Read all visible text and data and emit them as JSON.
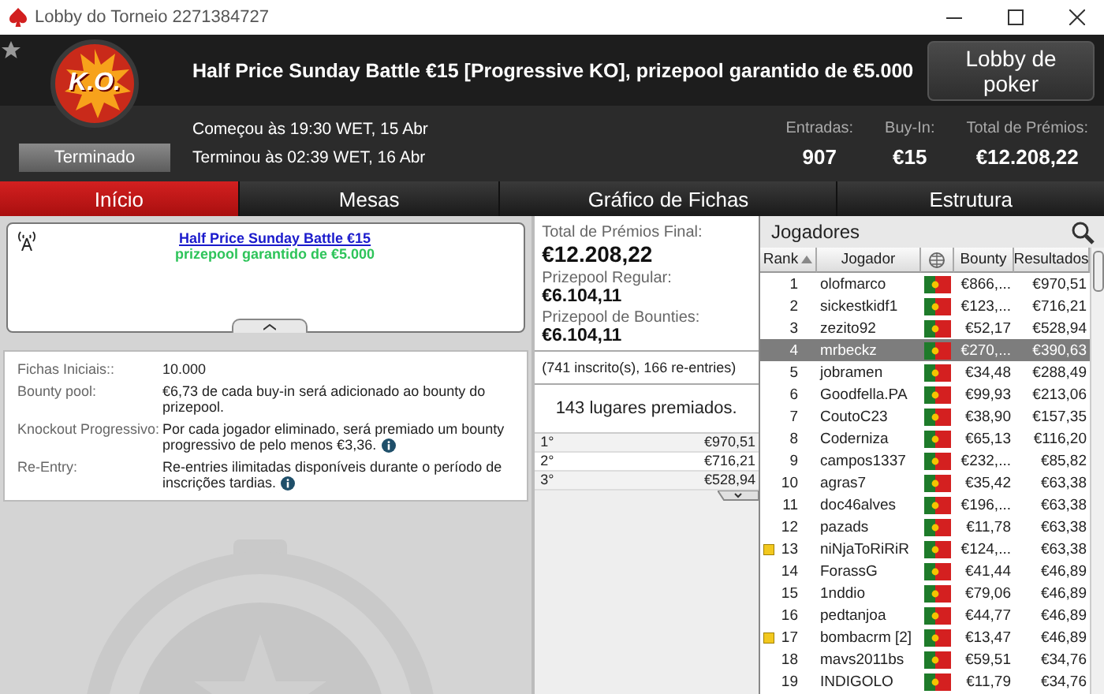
{
  "window": {
    "title": "Lobby do Torneio 2271384727"
  },
  "header": {
    "logo_text": "K.O.",
    "status": "Terminado",
    "title": "Half Price Sunday Battle €15 [Progressive KO], prizepool garantido de €5.000",
    "lobby_button": "Lobby de poker",
    "started": "Começou às 19:30 WET, 15 Abr",
    "ended": "Terminou às 02:39 WET, 16 Abr",
    "stats": [
      {
        "label": "Entradas:",
        "value": "907"
      },
      {
        "label": "Buy-In:",
        "value": "€15"
      },
      {
        "label": "Total de Prémios:",
        "value": "€12.208,22"
      }
    ]
  },
  "tabs": [
    {
      "label": "Início",
      "selected": true
    },
    {
      "label": "Mesas",
      "selected": false
    },
    {
      "label": "Gráfico de Fichas",
      "selected": false
    },
    {
      "label": "Estrutura",
      "selected": false
    }
  ],
  "news": {
    "link": "Half Price Sunday Battle €15",
    "subtitle": "prizepool garantido de €5.000"
  },
  "details": [
    {
      "label": "Fichas Iniciais::",
      "value": "10.000",
      "info": false
    },
    {
      "label": "Bounty pool:",
      "value": "€6,73 de cada buy-in será adicionado ao bounty do prizepool.",
      "info": false
    },
    {
      "label": "Knockout Progressivo:",
      "value": "Por cada jogador eliminado, será premiado um bounty progressivo de pelo menos €3,36.",
      "info": true
    },
    {
      "label": "Re-Entry:",
      "value": "Re-entries ilimitadas disponíveis durante o período de inscrições tardias.",
      "info": true
    }
  ],
  "prizes": {
    "totals": [
      {
        "label": "Total de Prémios Final:",
        "value": "€12.208,22"
      },
      {
        "label": "Prizepool Regular:",
        "value": "€6.104,11"
      },
      {
        "label": "Prizepool de Bounties:",
        "value": "€6.104,11"
      }
    ],
    "entries": "(741 inscrito(s), 166 re-entries)",
    "paid": "143 lugares premiados.",
    "places": [
      {
        "place": "1°",
        "amount": "€970,51"
      },
      {
        "place": "2°",
        "amount": "€716,21"
      },
      {
        "place": "3°",
        "amount": "€528,94"
      }
    ]
  },
  "players": {
    "title": "Jogadores",
    "columns": [
      "Rank",
      "Jogador",
      "Bounty",
      "Resultados"
    ],
    "rows": [
      {
        "rank": "1",
        "name": "olofmarco",
        "bounty": "€866,...",
        "result": "€970,51",
        "selected": false,
        "marked": false
      },
      {
        "rank": "2",
        "name": "sickestkidf1",
        "bounty": "€123,...",
        "result": "€716,21",
        "selected": false,
        "marked": false
      },
      {
        "rank": "3",
        "name": "zezito92",
        "bounty": "€52,17",
        "result": "€528,94",
        "selected": false,
        "marked": false
      },
      {
        "rank": "4",
        "name": "mrbeckz",
        "bounty": "€270,...",
        "result": "€390,63",
        "selected": true,
        "marked": false
      },
      {
        "rank": "5",
        "name": "jobramen",
        "bounty": "€34,48",
        "result": "€288,49",
        "selected": false,
        "marked": false
      },
      {
        "rank": "6",
        "name": "Goodfella.PA",
        "bounty": "€99,93",
        "result": "€213,06",
        "selected": false,
        "marked": false
      },
      {
        "rank": "7",
        "name": "CoutoC23",
        "bounty": "€38,90",
        "result": "€157,35",
        "selected": false,
        "marked": false
      },
      {
        "rank": "8",
        "name": "Coderniza",
        "bounty": "€65,13",
        "result": "€116,20",
        "selected": false,
        "marked": false
      },
      {
        "rank": "9",
        "name": "campos1337",
        "bounty": "€232,...",
        "result": "€85,82",
        "selected": false,
        "marked": false
      },
      {
        "rank": "10",
        "name": "agras7",
        "bounty": "€35,42",
        "result": "€63,38",
        "selected": false,
        "marked": false
      },
      {
        "rank": "11",
        "name": "doc46alves",
        "bounty": "€196,...",
        "result": "€63,38",
        "selected": false,
        "marked": false
      },
      {
        "rank": "12",
        "name": "pazads",
        "bounty": "€11,78",
        "result": "€63,38",
        "selected": false,
        "marked": false
      },
      {
        "rank": "13",
        "name": "niNjaToRiRiR",
        "bounty": "€124,...",
        "result": "€63,38",
        "selected": false,
        "marked": true
      },
      {
        "rank": "14",
        "name": "ForassG",
        "bounty": "€41,44",
        "result": "€46,89",
        "selected": false,
        "marked": false
      },
      {
        "rank": "15",
        "name": "1nddio",
        "bounty": "€79,06",
        "result": "€46,89",
        "selected": false,
        "marked": false
      },
      {
        "rank": "16",
        "name": "pedtanjoa",
        "bounty": "€44,77",
        "result": "€46,89",
        "selected": false,
        "marked": false
      },
      {
        "rank": "17",
        "name": "bombacrm [2]",
        "bounty": "€13,47",
        "result": "€46,89",
        "selected": false,
        "marked": true
      },
      {
        "rank": "18",
        "name": "mavs2011bs",
        "bounty": "€59,51",
        "result": "€34,76",
        "selected": false,
        "marked": false
      },
      {
        "rank": "19",
        "name": "INDIGOLO",
        "bounty": "€11,79",
        "result": "€34,76",
        "selected": false,
        "marked": false
      }
    ]
  }
}
